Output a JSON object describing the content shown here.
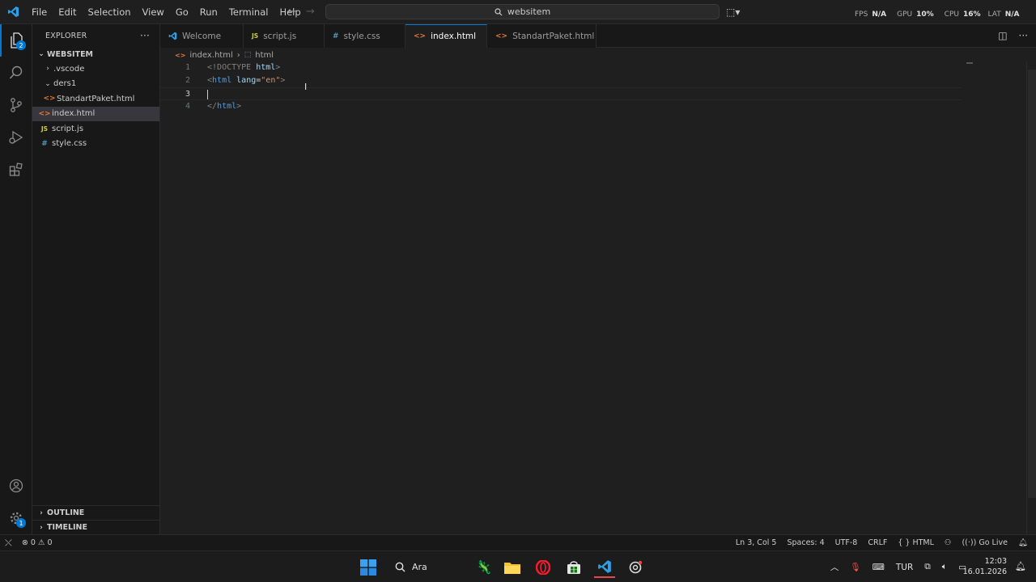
{
  "menu": [
    "File",
    "Edit",
    "Selection",
    "View",
    "Go",
    "Run",
    "Terminal",
    "Help"
  ],
  "search": {
    "text": "websitem"
  },
  "perf_overlay": {
    "fps_label": "FPS",
    "fps_value": "N/A",
    "gpu_label": "GPU",
    "gpu_value": "10%",
    "cpu_label": "CPU",
    "cpu_value": "16%",
    "lat_label": "LAT",
    "lat_value": "N/A"
  },
  "sidebar": {
    "title": "EXPLORER",
    "folder": "WEBSITEM",
    "tree": [
      {
        "label": ".vscode",
        "type": "folder",
        "level": 1
      },
      {
        "label": "ders1",
        "type": "folder-open",
        "level": 1
      },
      {
        "label": "StandartPaket.html",
        "type": "html",
        "level": 2
      },
      {
        "label": "index.html",
        "type": "html",
        "level": 1,
        "selected": true
      },
      {
        "label": "script.js",
        "type": "js",
        "level": 1
      },
      {
        "label": "style.css",
        "type": "css",
        "level": 1
      }
    ],
    "outline": "OUTLINE",
    "timeline": "TIMELINE"
  },
  "tabs": [
    {
      "label": "Welcome",
      "icon": "vscode-icon"
    },
    {
      "label": "script.js",
      "icon": "js-icon"
    },
    {
      "label": "style.css",
      "icon": "css-icon"
    },
    {
      "label": "index.html",
      "icon": "html-icon",
      "active": true,
      "dirty": true
    },
    {
      "label": "StandartPaket.html",
      "icon": "html-icon",
      "dirty": true
    }
  ],
  "breadcrumb": {
    "file": "index.html",
    "symbol": "html"
  },
  "editor": {
    "lines": [
      {
        "n": "1"
      },
      {
        "n": "2"
      },
      {
        "n": "3",
        "current": true
      },
      {
        "n": "4"
      }
    ],
    "code": {
      "l1_doctype": "!DOCTYPE",
      "l1_html": "html",
      "l2_tag": "html",
      "l2_attr": "lang",
      "l2_val": "\"en\"",
      "l4_tag": "html"
    }
  },
  "status": {
    "errors": "0",
    "warnings": "0",
    "position": "Ln 3, Col 5",
    "spaces": "Spaces: 4",
    "encoding": "UTF-8",
    "eol": "CRLF",
    "language": "HTML",
    "golive": "Go Live"
  },
  "taskbar": {
    "search": "Ara",
    "language": "TUR",
    "time": "12:03",
    "date": "16.01.2026"
  },
  "colors": {
    "accent": "#0078d4",
    "background": "#1f1f1f",
    "sidebar": "#181818",
    "html_icon": "#e37933",
    "js_icon": "#cbcb41",
    "css_icon": "#519aba"
  }
}
